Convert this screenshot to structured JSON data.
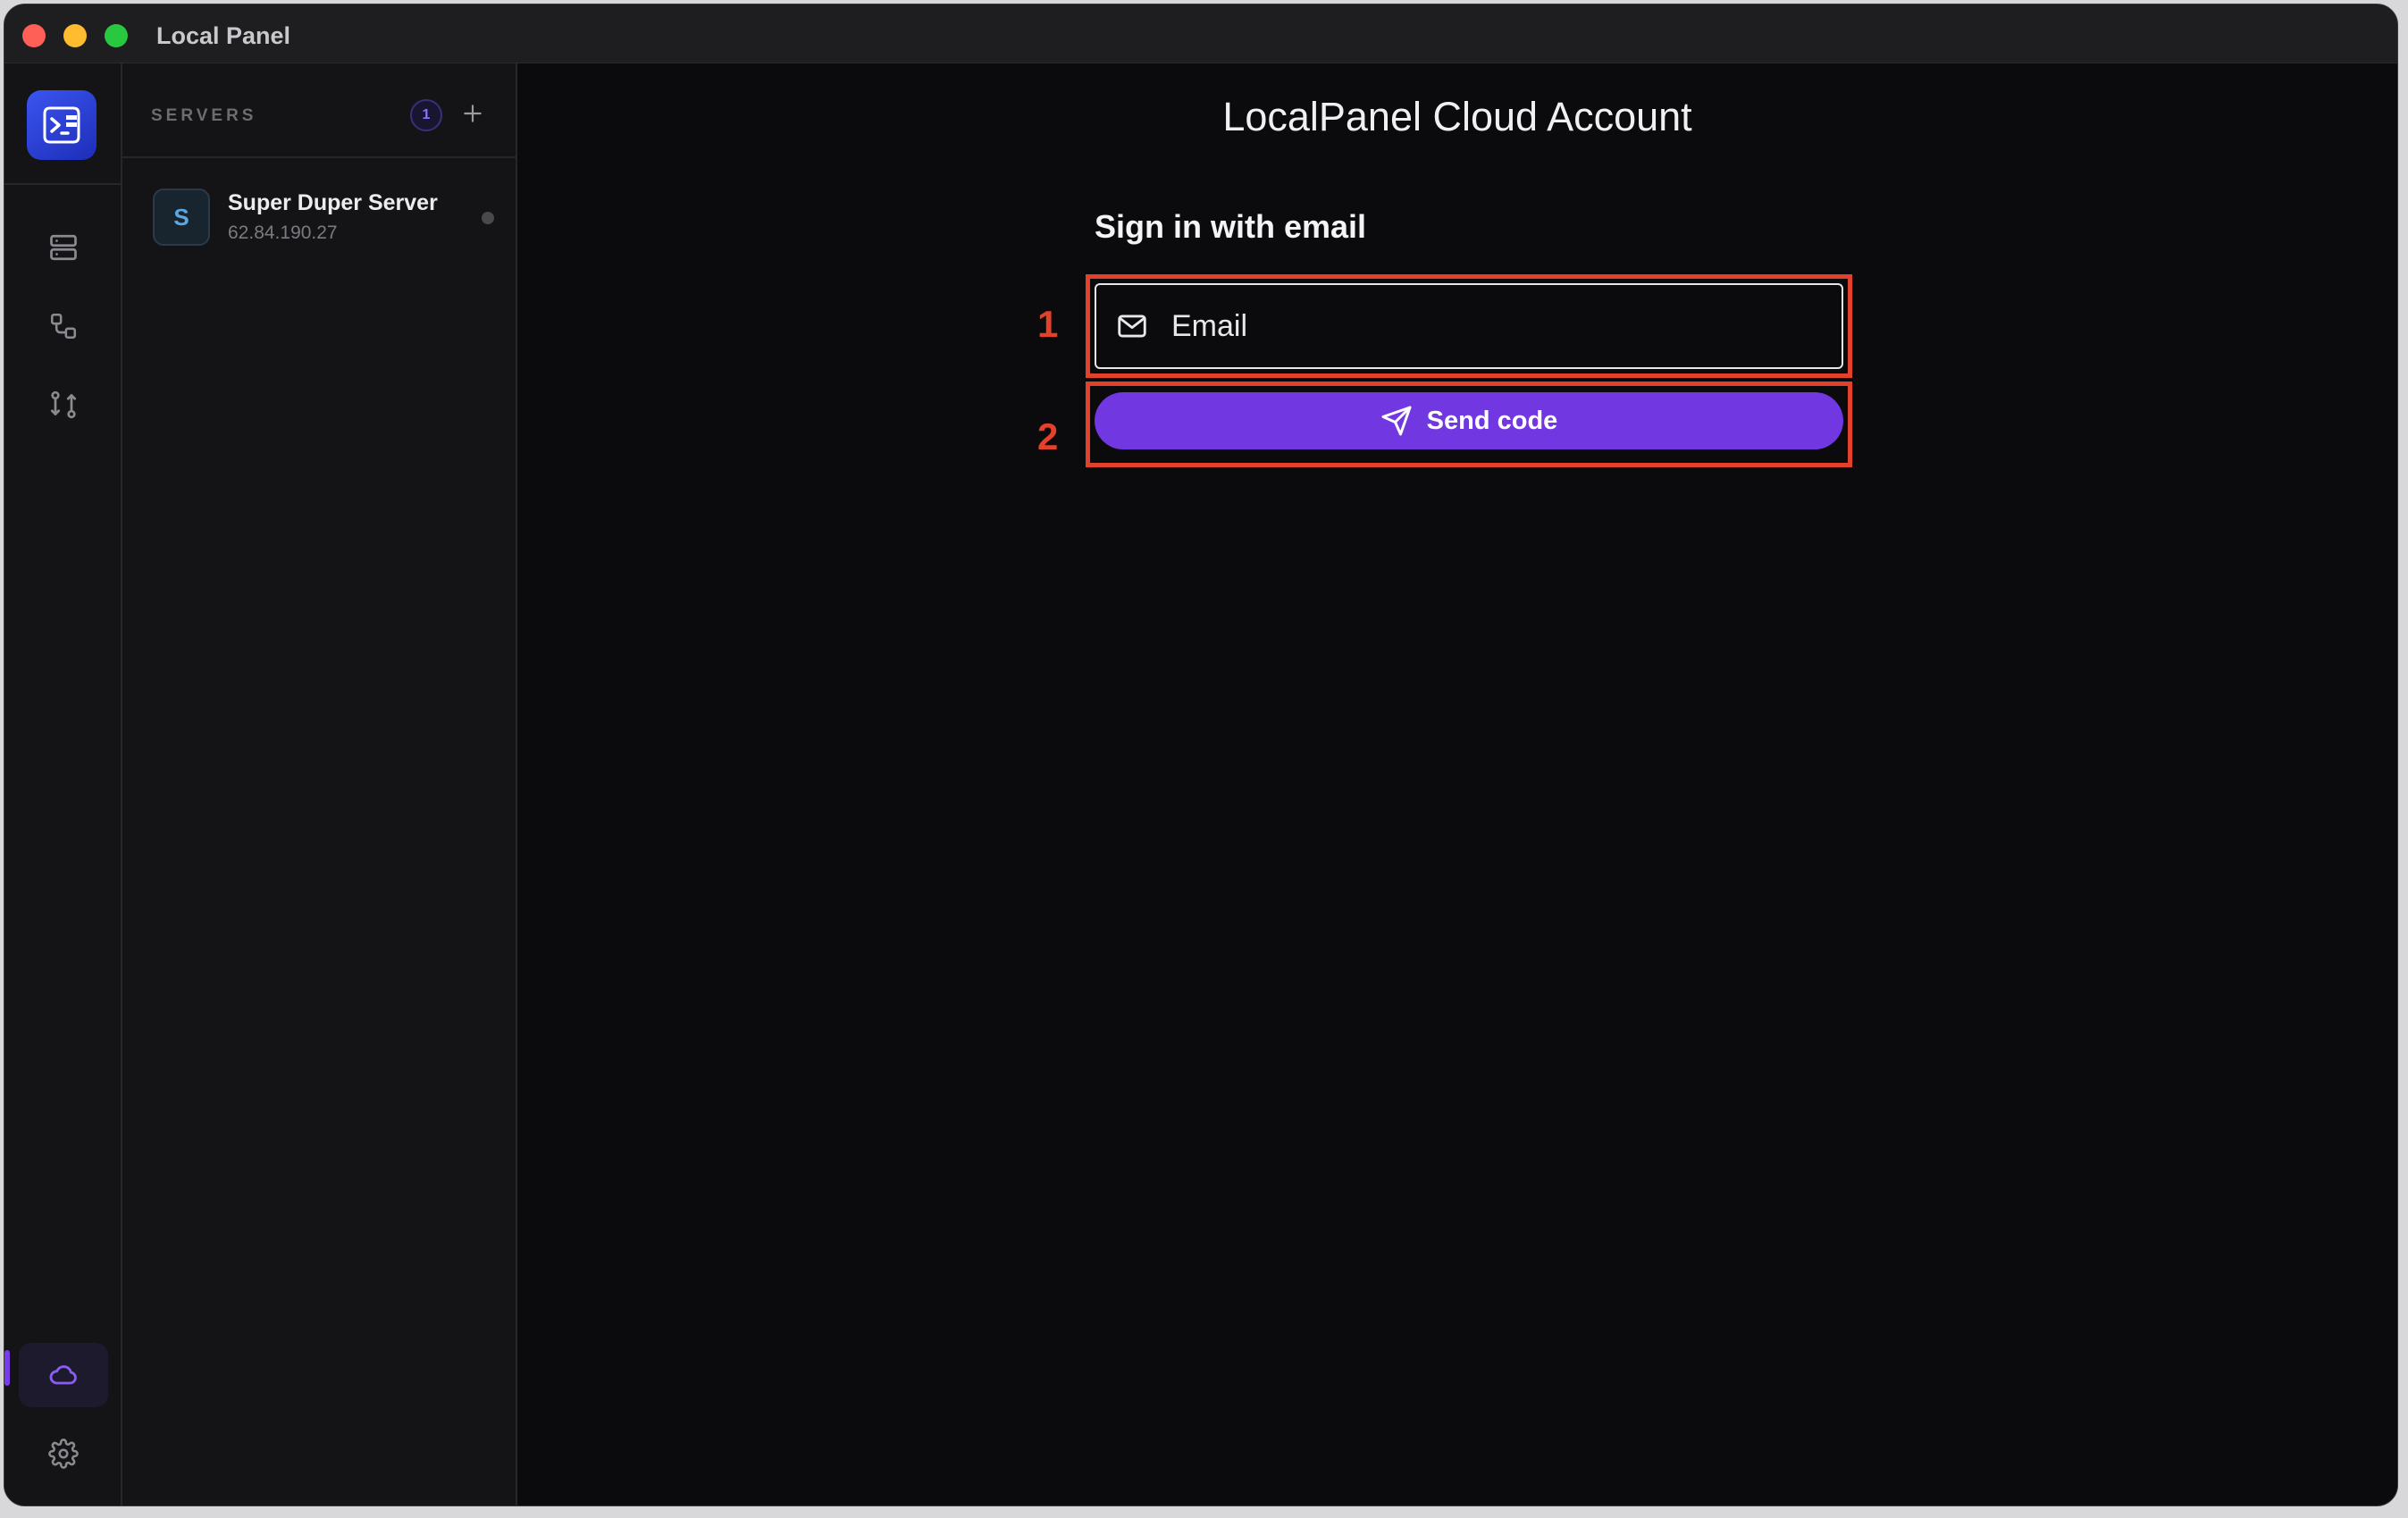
{
  "window": {
    "title": "Local Panel"
  },
  "rail": {
    "items": [
      {
        "icon": "server-stack-icon"
      },
      {
        "icon": "workflow-icon"
      },
      {
        "icon": "git-compare-icon"
      }
    ],
    "bottom_items": [
      {
        "icon": "cloud-icon",
        "active": true
      },
      {
        "icon": "gear-icon"
      }
    ]
  },
  "servers": {
    "label": "SERVERS",
    "count": "1",
    "items": [
      {
        "initial": "S",
        "name": "Super Duper Server",
        "ip": "62.84.190.27"
      }
    ]
  },
  "main": {
    "title": "LocalPanel Cloud Account",
    "form": {
      "title": "Sign in with email",
      "email_placeholder": "Email",
      "send_label": "Send code"
    },
    "annotations": [
      "1",
      "2"
    ]
  },
  "colors": {
    "accent": "#7137e0",
    "annotation": "#e2412c"
  }
}
